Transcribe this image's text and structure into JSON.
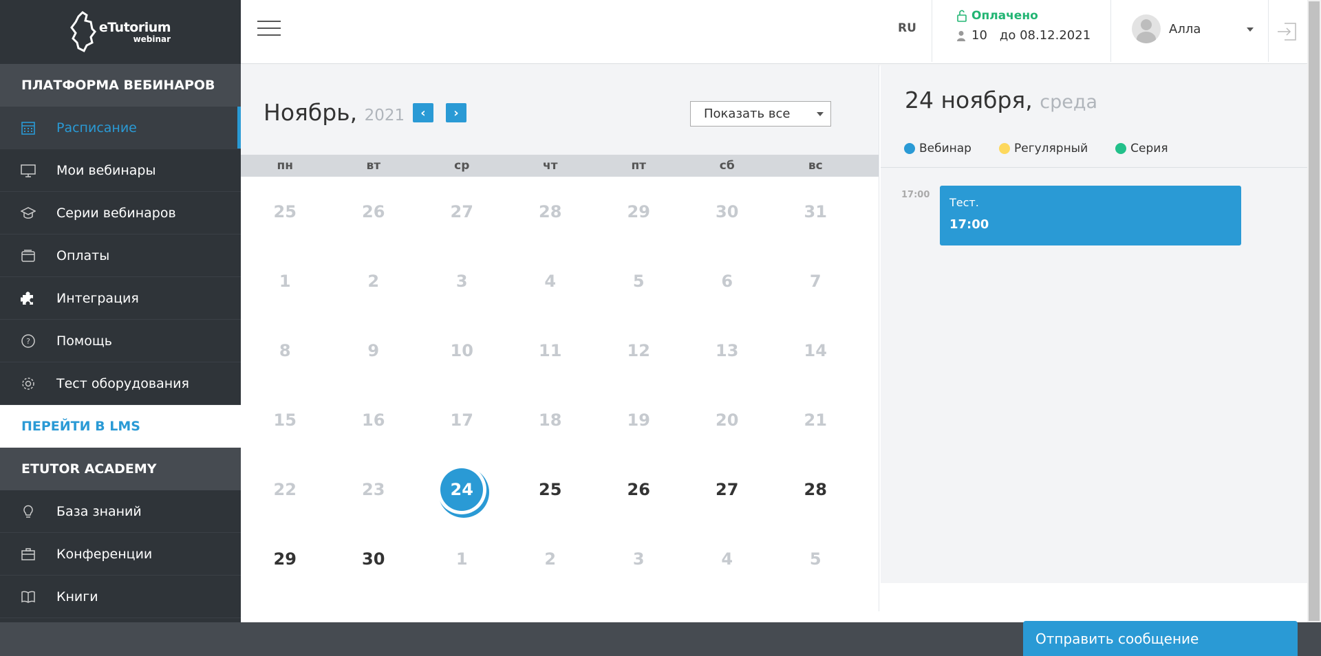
{
  "brand": {
    "logo_main": "eTutorium",
    "logo_sub": "webinar"
  },
  "sidebar": {
    "section_platform": "ПЛАТФОРМА ВЕБИНАРОВ",
    "items": [
      {
        "label": "Расписание",
        "icon": "calendar-icon"
      },
      {
        "label": "Мои вебинары",
        "icon": "monitor-icon"
      },
      {
        "label": "Серии вебинаров",
        "icon": "graduation-cap-icon"
      },
      {
        "label": "Оплаты",
        "icon": "wallet-icon"
      },
      {
        "label": "Интеграция",
        "icon": "puzzle-icon"
      },
      {
        "label": "Помощь",
        "icon": "question-circle-icon"
      },
      {
        "label": "Тест оборудования",
        "icon": "gear-icon"
      }
    ],
    "lms_link": "ПЕРЕЙТИ В LMS",
    "section_academy": "ETUTOR ACADEMY",
    "academy_items": [
      {
        "label": "База знаний",
        "icon": "lightbulb-icon"
      },
      {
        "label": "Конференции",
        "icon": "briefcase-icon"
      },
      {
        "label": "Книги",
        "icon": "book-icon"
      }
    ]
  },
  "header": {
    "lang": "RU",
    "plan_status": "Оплачено",
    "plan_seats": "10",
    "plan_until": "до 08.12.2021",
    "user_name": "Алла"
  },
  "calendar": {
    "month": "Ноябрь,",
    "year": "2021",
    "filter": "Показать все",
    "weekdays": [
      "пн",
      "вт",
      "ср",
      "чт",
      "пт",
      "сб",
      "вс"
    ],
    "weeks": [
      [
        "25",
        "26",
        "27",
        "28",
        "29",
        "30",
        "31"
      ],
      [
        "1",
        "2",
        "3",
        "4",
        "5",
        "6",
        "7"
      ],
      [
        "8",
        "9",
        "10",
        "11",
        "12",
        "13",
        "14"
      ],
      [
        "15",
        "16",
        "17",
        "18",
        "19",
        "20",
        "21"
      ],
      [
        "22",
        "23",
        "24",
        "25",
        "26",
        "27",
        "28"
      ],
      [
        "29",
        "30",
        "1",
        "2",
        "3",
        "4",
        "5"
      ]
    ],
    "today": "24"
  },
  "day_panel": {
    "date": "24 ноября,",
    "weekday": "среда",
    "legend": [
      {
        "label": "Вебинар",
        "color": "#2a9ad5"
      },
      {
        "label": "Регулярный",
        "color": "#fdd85d"
      },
      {
        "label": "Серия",
        "color": "#22c08a"
      }
    ],
    "time_label": "17:00",
    "event": {
      "title": "Тест.",
      "time": "17:00"
    }
  },
  "chat_button": "Отправить сообщение",
  "colors": {
    "accent": "#2a9ad5",
    "sidebar_bg": "#2f3439",
    "paid": "#22b573"
  }
}
